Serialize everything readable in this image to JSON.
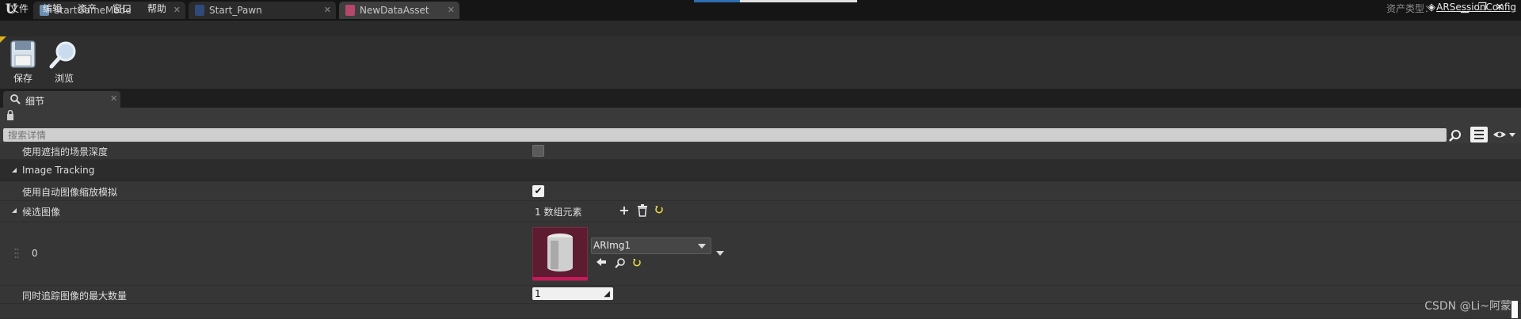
{
  "window": {
    "tabs": [
      {
        "label": "StartGameMode",
        "icon": "blueprint-icon",
        "active": false
      },
      {
        "label": "Start_Pawn",
        "icon": "pawn-icon",
        "active": false
      },
      {
        "label": "NewDataAsset",
        "icon": "data-asset-icon",
        "active": true
      }
    ],
    "close_glyph": "✕"
  },
  "menu": {
    "items": [
      "文件",
      "编辑",
      "资产",
      "窗口",
      "帮助"
    ],
    "asset_type_label": "资产类型：",
    "asset_type_value": "ARSessionConfig"
  },
  "toolbar": {
    "save_label": "保存",
    "browse_label": "浏览"
  },
  "details": {
    "tab_label": "细节",
    "search_placeholder": "搜索详情",
    "rows": {
      "occlusion_label": "使用遮挡的场景深度",
      "occlusion_checked": false,
      "image_tracking_category": "Image Tracking",
      "auto_scale_label": "使用自动图像缩放模拟",
      "auto_scale_checked": true,
      "candidates_label": "候选图像",
      "candidates_count": "1 数组元素",
      "element_index": "0",
      "element_asset": "ARImg1",
      "max_images_label": "同时追踪图像的最大数量",
      "max_images_value": "1"
    }
  },
  "watermark": "CSDN @Li~阿蒙",
  "colors": {
    "accent_magenta": "#c61a5a",
    "thumbnail_bg": "#5e1c30",
    "reset_arrow": "#e8d84a"
  }
}
